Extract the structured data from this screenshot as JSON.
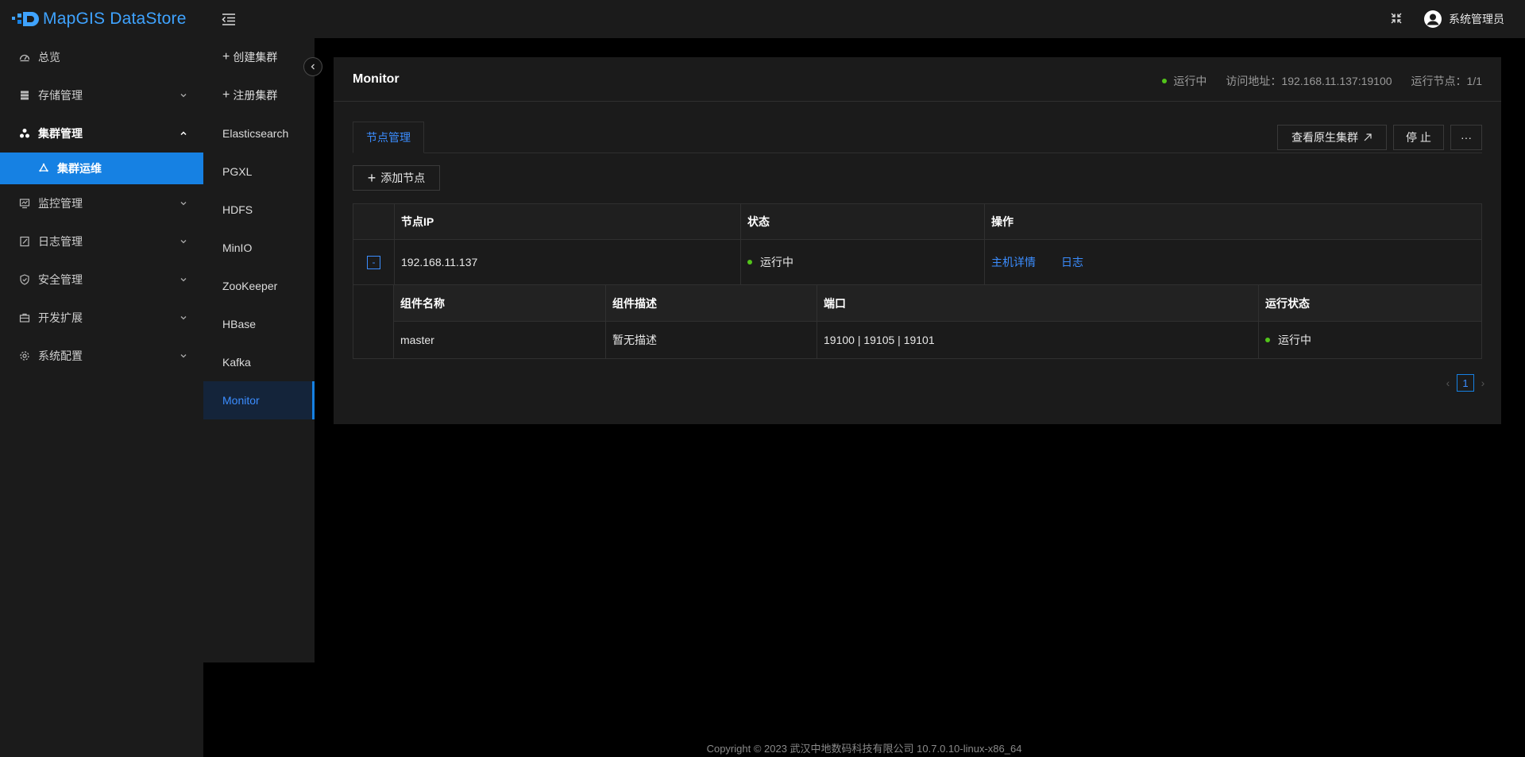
{
  "app": {
    "logo_text": "MapGIS DataStore",
    "accent_color": "#1681e3",
    "status_color": "#52c41a"
  },
  "sidebar": {
    "items": [
      {
        "label": "总览",
        "icon": "dashboard-icon"
      },
      {
        "label": "存储管理",
        "icon": "storage-icon"
      },
      {
        "label": "集群管理",
        "icon": "cluster-icon"
      },
      {
        "label": "集群运维",
        "icon": "recycle-icon"
      },
      {
        "label": "监控管理",
        "icon": "monitor-icon"
      },
      {
        "label": "日志管理",
        "icon": "log-icon"
      },
      {
        "label": "安全管理",
        "icon": "shield-icon"
      },
      {
        "label": "开发扩展",
        "icon": "toolbox-icon"
      },
      {
        "label": "系统配置",
        "icon": "gear-icon"
      }
    ]
  },
  "header": {
    "user_name": "系统管理员"
  },
  "cluster_panel": {
    "create_label": "创建集群",
    "register_label": "注册集群",
    "clusters": [
      "Elasticsearch",
      "PGXL",
      "HDFS",
      "MinIO",
      "ZooKeeper",
      "HBase",
      "Kafka",
      "Monitor"
    ],
    "active": "Monitor"
  },
  "main": {
    "title": "Monitor",
    "status": "运行中",
    "address": "访问地址：192.168.11.137:19100",
    "nodes": "运行节点：1/1",
    "tab_label": "节点管理",
    "view_native_label": "查看原生集群",
    "stop_label": "停 止",
    "more_label": "···",
    "add_node_label": "添加节点",
    "node_table": {
      "columns": [
        "节点IP",
        "状态",
        "操作"
      ],
      "rows": [
        {
          "ip": "192.168.11.137",
          "status": "运行中",
          "action_detail": "主机详情",
          "action_log": "日志",
          "expand_symbol": "-"
        }
      ]
    },
    "component_table": {
      "columns": [
        "组件名称",
        "组件描述",
        "端口",
        "运行状态"
      ],
      "rows": [
        {
          "name": "master",
          "desc": "暂无描述",
          "ports": "19100 | 19105 | 19101",
          "status": "运行中"
        }
      ]
    },
    "pagination": {
      "prev": "‹",
      "current": "1",
      "next": "›"
    }
  },
  "footer": {
    "text": "Copyright © 2023 武汉中地数码科技有限公司 10.7.0.10-linux-x86_64"
  }
}
